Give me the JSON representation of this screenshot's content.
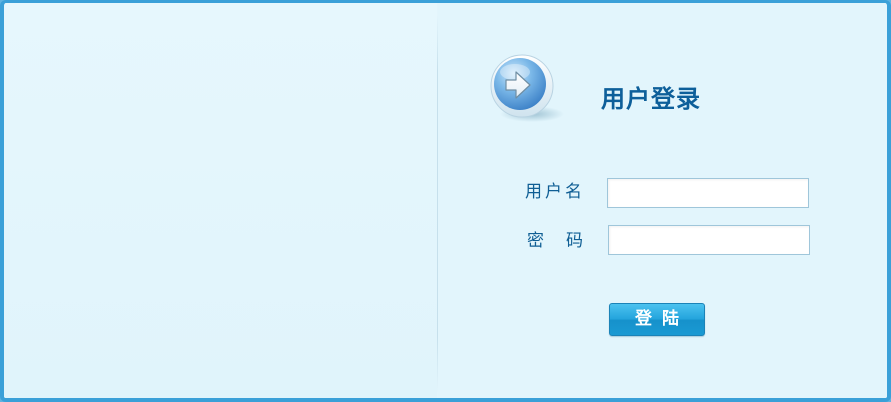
{
  "login": {
    "title": "用户登录",
    "username_label": "用户名",
    "password_label": "密码",
    "username_value": "",
    "password_value": "",
    "submit_label": "登陆"
  },
  "colors": {
    "frame_border": "#3aa0d8",
    "background": "#e3f5fc",
    "title_text": "#0d5f9a",
    "label_text": "#0f5e94",
    "button": "#22a3dc"
  },
  "icons": {
    "logo": "arrow-right-circle-icon"
  }
}
